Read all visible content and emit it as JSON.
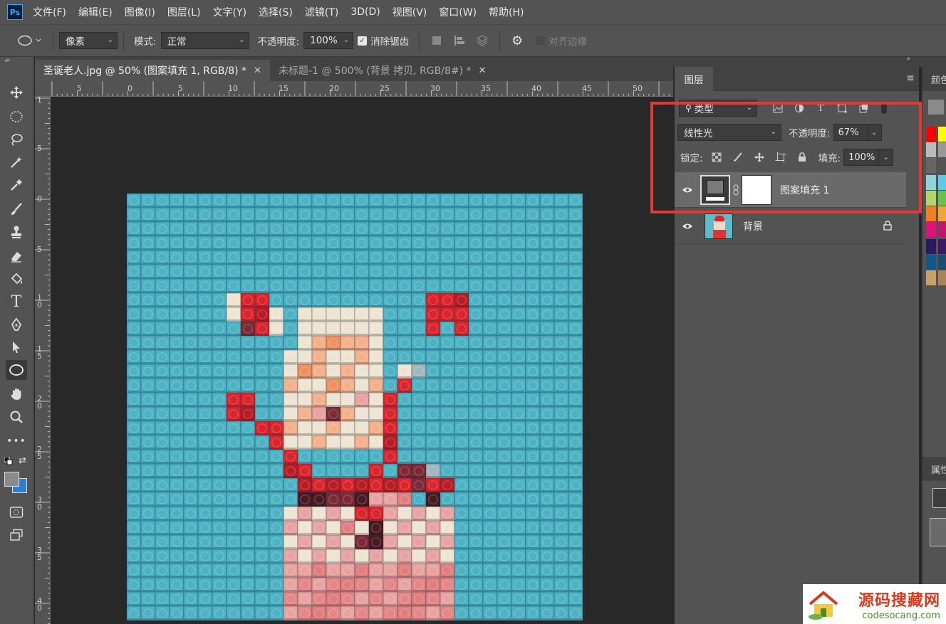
{
  "app": {
    "logo_text": "Ps",
    "menu": [
      "文件(F)",
      "编辑(E)",
      "图像(I)",
      "图层(L)",
      "文字(Y)",
      "选择(S)",
      "滤镜(T)",
      "3D(D)",
      "视图(V)",
      "窗口(W)",
      "帮助(H)"
    ]
  },
  "options_bar": {
    "shape_mode": "像素",
    "mode_label": "模式:",
    "mode_value": "正常",
    "opacity_label": "不透明度:",
    "opacity_value": "100%",
    "antialias_label": "消除锯齿",
    "antialias_checked": true,
    "align_edges_label": "对齐边缘"
  },
  "document_tabs": [
    {
      "label": "圣诞老人.jpg @ 50% (图案填充 1, RGB/8) *",
      "active": true
    },
    {
      "label": "未标题-1 @ 500% (背景 拷贝, RGB/8#) *",
      "active": false
    }
  ],
  "rulers": {
    "horizontal": [
      "5",
      "0",
      "5",
      "10",
      "15",
      "20",
      "25",
      "30",
      "35",
      "40",
      "45",
      "50"
    ],
    "vertical": [
      "1",
      "5",
      "0",
      "5",
      "1\n0",
      "1\n5",
      "2\n0",
      "2\n5",
      "3\n0",
      "3\n5",
      "4\n0"
    ]
  },
  "layers_panel": {
    "tab_label": "图层",
    "filter_kind": "类型",
    "blend_mode": "线性光",
    "opacity_label": "不透明度:",
    "opacity_value": "67%",
    "lock_label": "锁定:",
    "fill_label": "填充:",
    "fill_value": "100%",
    "layers": [
      {
        "name": "图案填充 1",
        "selected": true,
        "visible": true,
        "locked": false
      },
      {
        "name": "背景",
        "selected": false,
        "visible": true,
        "locked": true
      }
    ]
  },
  "color_panel": {
    "tab_label": "颜色",
    "swatches": [
      "#ff0000",
      "#ffff00",
      "#bbbbbb",
      "#8fd3dc",
      "#b0d66a",
      "#f07f20",
      "#e0117f",
      "#2a1a5e",
      "#0c5a8a",
      "#c9a06a"
    ]
  },
  "properties_panel": {
    "tab_label": "属性"
  },
  "watermark": {
    "title": "源码搜藏网",
    "url": "codesocang.com"
  },
  "colors": {
    "highlight": "#e53935",
    "tile_background": "#4db3c4"
  }
}
